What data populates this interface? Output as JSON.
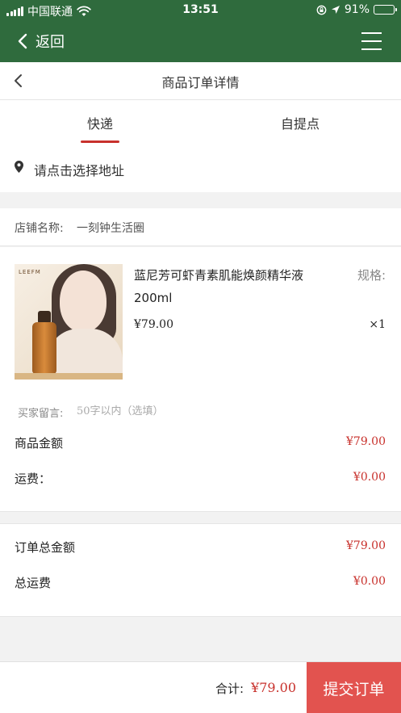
{
  "status_bar": {
    "carrier": "中国联通",
    "time": "13:51",
    "battery": "91%",
    "battery_level": 0.91
  },
  "app_header": {
    "back_label": "返回",
    "menu_icon": "hamburger-menu-icon"
  },
  "page": {
    "title": "商品订单详情"
  },
  "tabs": [
    {
      "label": "快递",
      "active": true
    },
    {
      "label": "自提点",
      "active": false
    }
  ],
  "address": {
    "icon": "location-pin-icon",
    "prompt": "请点击选择地址"
  },
  "shop": {
    "label": "店铺名称:",
    "name": "一刻钟生活圈"
  },
  "product": {
    "name": "蓝尼芳可虾青素肌能焕颜精华液200ml",
    "spec_label": "规格:",
    "price": "¥79.00",
    "quantity": "×1",
    "image_brand": "LEEFM"
  },
  "message": {
    "label": "买家留言:",
    "placeholder": "50字以内（选填）",
    "value": ""
  },
  "summary": {
    "goods_amount_label": "商品金额",
    "goods_amount": "¥79.00",
    "shipping_label": "运费：",
    "shipping": "¥0.00"
  },
  "totals": {
    "order_total_label": "订单总金额",
    "order_total": "¥79.00",
    "total_shipping_label": "总运费",
    "total_shipping": "¥0.00"
  },
  "bottom_bar": {
    "sum_label": "合计:",
    "sum_value": "¥79.00",
    "submit_label": "提交订单"
  },
  "colors": {
    "header_green": "#2f6b3d",
    "accent_red": "#c8312c",
    "submit_button": "#e2534f"
  }
}
